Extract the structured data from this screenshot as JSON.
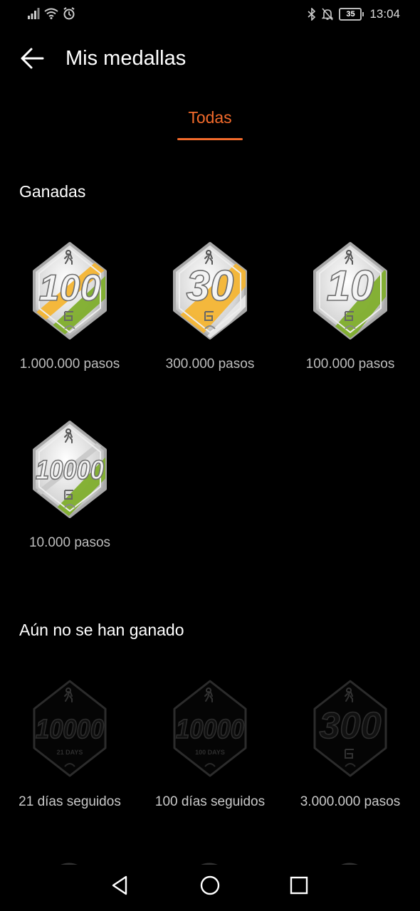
{
  "status": {
    "time": "13:04",
    "battery": "35",
    "left_icons": [
      "signal-icon",
      "wifi-icon",
      "alarm-icon"
    ],
    "right_icons": [
      "bluetooth-icon",
      "notifications-off-icon",
      "battery-icon"
    ]
  },
  "header": {
    "title": "Mis medallas",
    "back_icon": "arrow-left-icon"
  },
  "tabs": [
    {
      "label": "Todas",
      "active": true
    }
  ],
  "colors": {
    "accent": "#f26a2b",
    "yellow": "#f4b533",
    "green": "#7fae2c"
  },
  "sections": {
    "earned": {
      "title": "Ganadas",
      "medals": [
        {
          "number": "100",
          "label": "1.000.000 pasos"
        },
        {
          "number": "30",
          "label": "300.000 pasos"
        },
        {
          "number": "10",
          "label": "100.000 pasos"
        },
        {
          "number": "10000",
          "label": "10.000 pasos"
        }
      ]
    },
    "locked": {
      "title": "Aún no se han ganado",
      "medals": [
        {
          "number": "10000",
          "subtitle": "21 DAYS",
          "label": "21 días seguidos"
        },
        {
          "number": "10000",
          "subtitle": "100 DAYS",
          "label": "100 días seguidos"
        },
        {
          "number": "300",
          "subtitle": "",
          "label": "3.000.000 pasos"
        }
      ]
    }
  },
  "navbar": {
    "icons": [
      "back-triangle-icon",
      "home-circle-icon",
      "recents-square-icon"
    ]
  }
}
